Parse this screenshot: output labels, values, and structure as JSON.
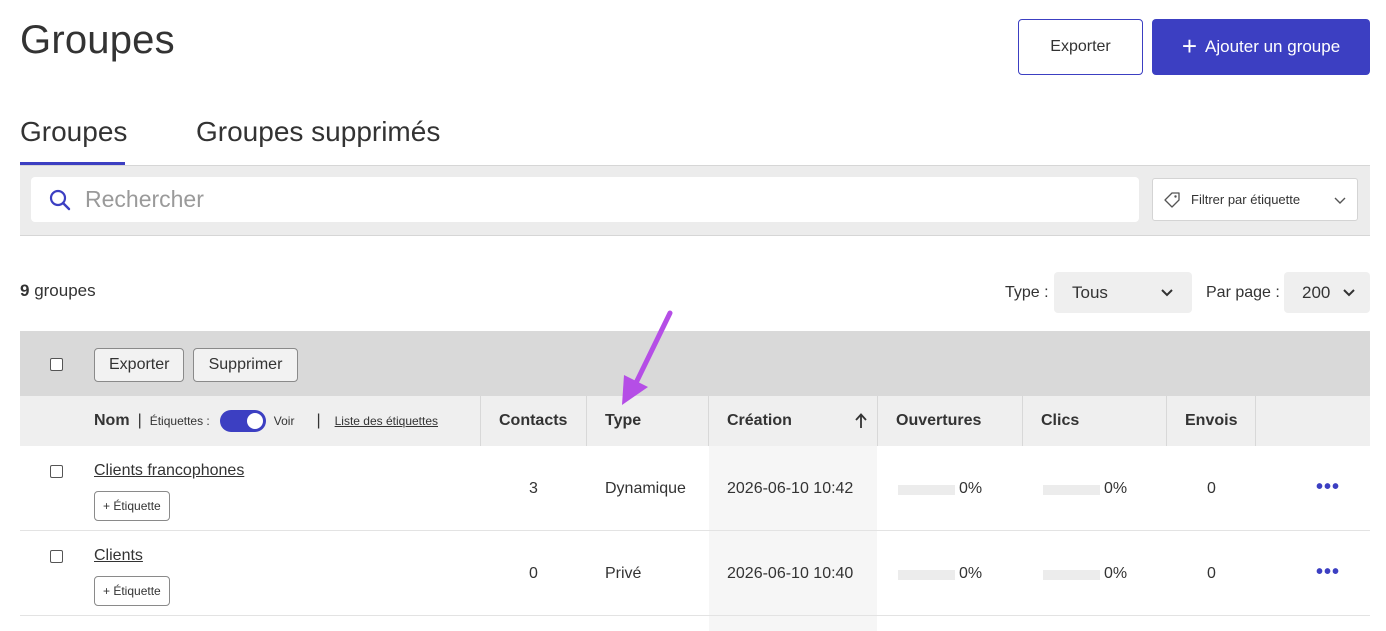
{
  "page": {
    "title": "Groupes"
  },
  "header": {
    "export_label": "Exporter",
    "add_label": "Ajouter un groupe"
  },
  "tabs": [
    {
      "label": "Groupes",
      "active": true
    },
    {
      "label": "Groupes supprimés",
      "active": false
    }
  ],
  "search": {
    "placeholder": "Rechercher",
    "value": ""
  },
  "tag_filter": {
    "label": "Filtrer par étiquette"
  },
  "summary": {
    "count": "9",
    "count_suffix": " groupes"
  },
  "type_filter": {
    "label": "Type :",
    "value": "Tous"
  },
  "per_page": {
    "label": "Par page :",
    "value": "200"
  },
  "bulk": {
    "export_label": "Exporter",
    "delete_label": "Supprimer"
  },
  "columns": {
    "name": "Nom",
    "tags_label": "Étiquettes :",
    "toggle_label": "Voir",
    "tags_list_link": "Liste des étiquettes",
    "contacts": "Contacts",
    "type": "Type",
    "creation": "Création",
    "opens": "Ouvertures",
    "clicks": "Clics",
    "sends": "Envois"
  },
  "rows": [
    {
      "name": "Clients francophones",
      "tag_button": "+ Étiquette",
      "contacts": "3",
      "type": "Dynamique",
      "created": "2026-06-10 10:42",
      "opens": "0%",
      "opens_fraction": 0,
      "clicks": "0%",
      "clicks_fraction": 0,
      "sends": "0",
      "more": "•••"
    },
    {
      "name": "Clients",
      "tag_button": "+ Étiquette",
      "contacts": "0",
      "type": "Privé",
      "created": "2026-06-10 10:40",
      "opens": "0%",
      "opens_fraction": 0,
      "clicks": "0%",
      "clicks_fraction": 0,
      "sends": "0",
      "more": "•••"
    }
  ],
  "colors": {
    "accent": "#3c3fc2",
    "annotation_arrow": "#b54ee6"
  }
}
